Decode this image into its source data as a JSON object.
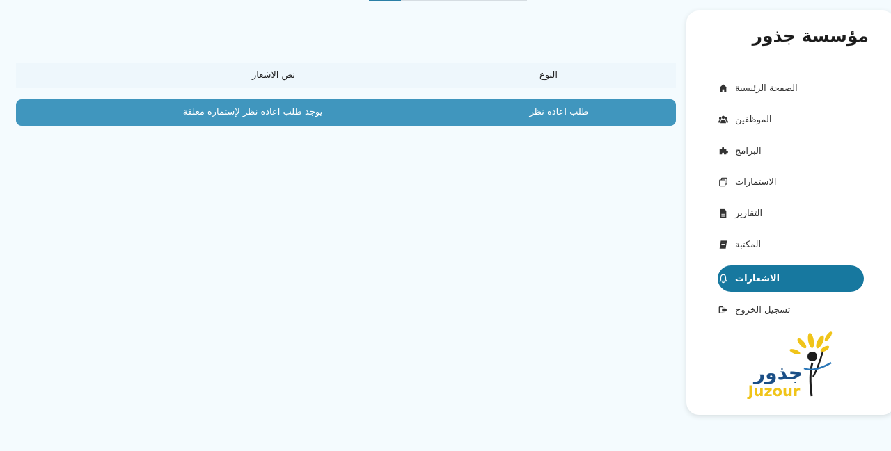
{
  "brand": {
    "title": "مؤسسة جذور"
  },
  "sidebar": {
    "items": [
      {
        "label": "الصفحة الرئيسية",
        "icon": "home-icon"
      },
      {
        "label": "الموظفين",
        "icon": "users-icon"
      },
      {
        "label": "البرامج",
        "icon": "puzzle-icon"
      },
      {
        "label": "الاستمارات",
        "icon": "copy-icon"
      },
      {
        "label": "التقارير",
        "icon": "file-icon"
      },
      {
        "label": "المكتبة",
        "icon": "book-icon"
      },
      {
        "label": "الاشعارات",
        "icon": "bell-icon",
        "active": true
      },
      {
        "label": "تسجيل الخروج",
        "icon": "logout-icon"
      }
    ]
  },
  "logo": {
    "arabic": "جذور",
    "latin": "Juzour"
  },
  "table": {
    "headers": {
      "type": "النوع",
      "text": "نص الاشعار"
    },
    "rows": [
      {
        "type": "طلب اعادة نظر",
        "text": "يوجد طلب اعادة نظر لإستمارة مغلقة"
      }
    ]
  },
  "colors": {
    "accent": "#17789f",
    "row": "#4096be",
    "logo_yellow": "#f0c419",
    "logo_blue": "#1b4f86"
  }
}
